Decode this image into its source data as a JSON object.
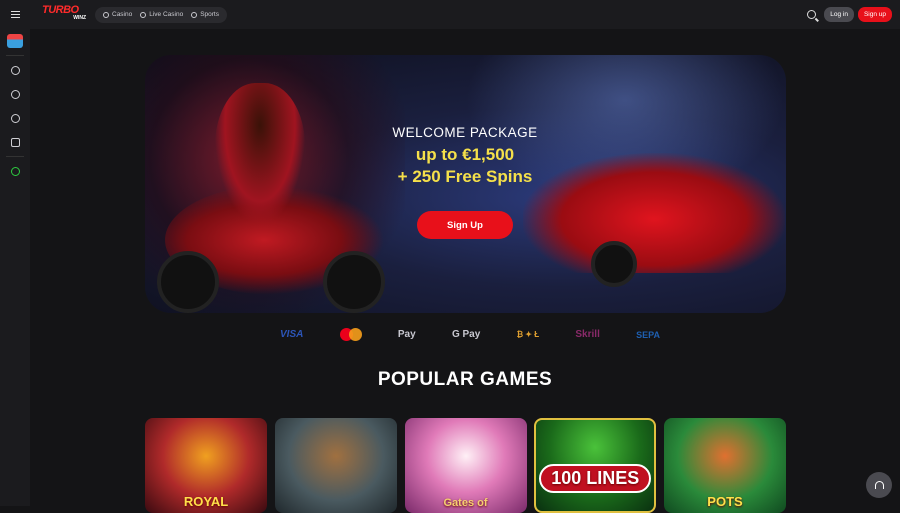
{
  "header": {
    "logo_text": "TURBO",
    "logo_sub": "WINZ",
    "nav": [
      {
        "label": "Casino",
        "icon": "casino-chip-icon"
      },
      {
        "label": "Live Casino",
        "icon": "live-broadcast-icon"
      },
      {
        "label": "Sports",
        "icon": "sports-ball-icon"
      }
    ],
    "login_label": "Log in",
    "signup_label": "Sign up"
  },
  "sidebar": {
    "items": [
      "promotions-icon",
      "casino-chip-icon",
      "live-broadcast-icon",
      "soccer-ball-icon",
      "gamepad-icon",
      "support-headset-icon"
    ]
  },
  "hero": {
    "subtitle": "WELCOME PACKAGE",
    "line1": "up to €1,500",
    "line2": "+ 250 Free Spins",
    "cta_label": "Sign Up"
  },
  "payments": {
    "visa": "VISA",
    "applepay": "Pay",
    "gpay": "G Pay",
    "crypto": "₿ ✦ Ł",
    "skrill": "Skrill",
    "sepa": "SEPA"
  },
  "section_title": "POPULAR GAMES",
  "games": [
    {
      "title": "ROYAL"
    },
    {
      "title": ""
    },
    {
      "title": "Gates of"
    },
    {
      "title": "100 LINES"
    },
    {
      "title": "POTS"
    }
  ],
  "colors": {
    "accent": "#e8101a",
    "bonus_text": "#f5e04a",
    "background": "#141416"
  }
}
